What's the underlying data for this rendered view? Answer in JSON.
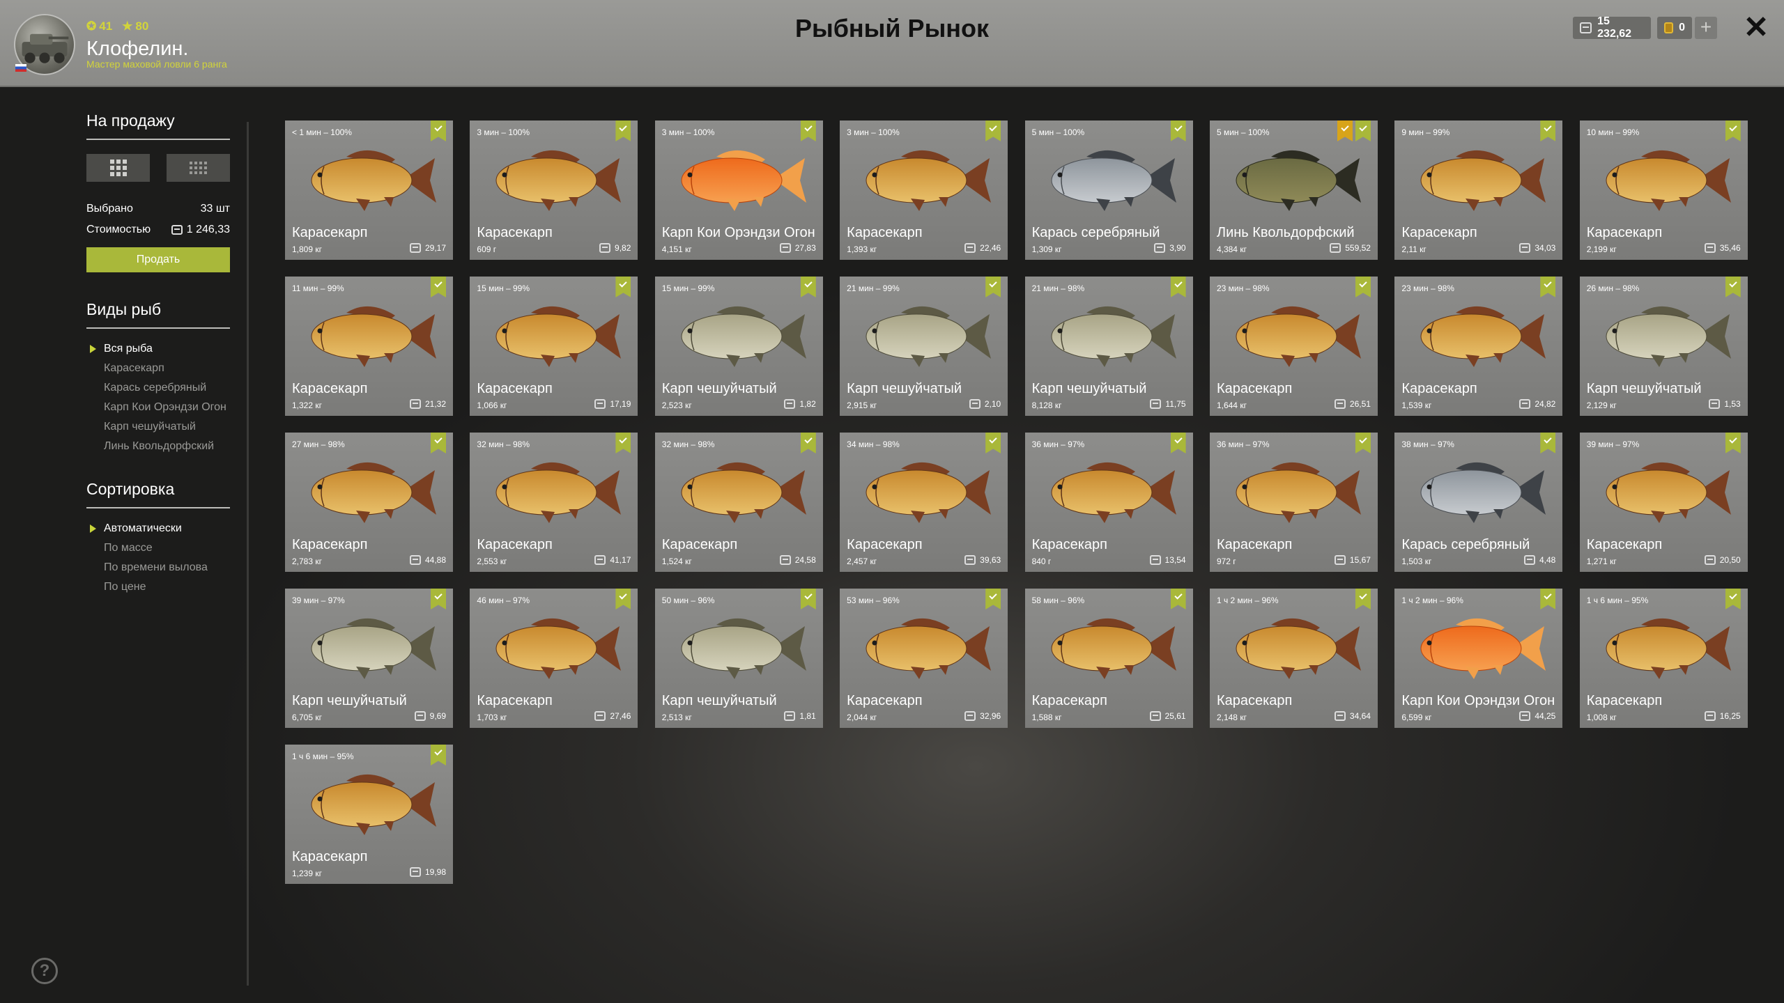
{
  "player": {
    "level": "41",
    "stars": "80",
    "name": "Клофелин.",
    "rank": "Мастер маховой ловли 6 ранга"
  },
  "title": "Рыбный Рынок",
  "currency": {
    "silver": "15 232,62",
    "gold": "0"
  },
  "sidebar": {
    "sale_title": "На продажу",
    "selected_label": "Выбрано",
    "selected_value": "33 шт",
    "cost_label": "Стоимостью",
    "cost_value": "1 246,33",
    "sell_button": "Продать",
    "species_title": "Виды рыб",
    "species": [
      "Вся рыба",
      "Карасекарп",
      "Карась серебряный",
      "Карп Кои Орэндзи Огон",
      "Карп чешуйчатый",
      "Линь Квольдорфский"
    ],
    "sort_title": "Сортировка",
    "sort": [
      "Автоматически",
      "По массе",
      "По времени вылова",
      "По цене"
    ]
  },
  "colors": {
    "accent": "#a9b83a",
    "favorite": "#d8a41a"
  },
  "fish": [
    {
      "time": "< 1 мин – 100%",
      "name": "Карасекарп",
      "weight": "1,809 кг",
      "price": "29,17",
      "kind": "crucian"
    },
    {
      "time": "3 мин – 100%",
      "name": "Карасекарп",
      "weight": "609 г",
      "price": "9,82",
      "kind": "crucian"
    },
    {
      "time": "3 мин – 100%",
      "name": "Карп Кои Орэндзи Огон",
      "weight": "4,151 кг",
      "price": "27,83",
      "kind": "koi"
    },
    {
      "time": "3 мин – 100%",
      "name": "Карасекарп",
      "weight": "1,393 кг",
      "price": "22,46",
      "kind": "crucian"
    },
    {
      "time": "5 мин – 100%",
      "name": "Карась серебряный",
      "weight": "1,309 кг",
      "price": "3,90",
      "kind": "silver"
    },
    {
      "time": "5 мин – 100%",
      "name": "Линь Квольдорфский",
      "weight": "4,384 кг",
      "price": "559,52",
      "kind": "tench",
      "favorite": true
    },
    {
      "time": "9 мин – 99%",
      "name": "Карасекарп",
      "weight": "2,11 кг",
      "price": "34,03",
      "kind": "crucian"
    },
    {
      "time": "10 мин – 99%",
      "name": "Карасекарп",
      "weight": "2,199 кг",
      "price": "35,46",
      "kind": "crucian"
    },
    {
      "time": "11 мин – 99%",
      "name": "Карасекарп",
      "weight": "1,322 кг",
      "price": "21,32",
      "kind": "crucian"
    },
    {
      "time": "15 мин – 99%",
      "name": "Карасекарп",
      "weight": "1,066 кг",
      "price": "17,19",
      "kind": "crucian"
    },
    {
      "time": "15 мин – 99%",
      "name": "Карп чешуйчатый",
      "weight": "2,523 кг",
      "price": "1,82",
      "kind": "carp"
    },
    {
      "time": "21 мин – 99%",
      "name": "Карп чешуйчатый",
      "weight": "2,915 кг",
      "price": "2,10",
      "kind": "carp"
    },
    {
      "time": "21 мин – 98%",
      "name": "Карп чешуйчатый",
      "weight": "8,128 кг",
      "price": "11,75",
      "kind": "carp"
    },
    {
      "time": "23 мин – 98%",
      "name": "Карасекарп",
      "weight": "1,644 кг",
      "price": "26,51",
      "kind": "crucian"
    },
    {
      "time": "23 мин – 98%",
      "name": "Карасекарп",
      "weight": "1,539 кг",
      "price": "24,82",
      "kind": "crucian"
    },
    {
      "time": "26 мин – 98%",
      "name": "Карп чешуйчатый",
      "weight": "2,129 кг",
      "price": "1,53",
      "kind": "carp"
    },
    {
      "time": "27 мин – 98%",
      "name": "Карасекарп",
      "weight": "2,783 кг",
      "price": "44,88",
      "kind": "crucian"
    },
    {
      "time": "32 мин – 98%",
      "name": "Карасекарп",
      "weight": "2,553 кг",
      "price": "41,17",
      "kind": "crucian"
    },
    {
      "time": "32 мин – 98%",
      "name": "Карасекарп",
      "weight": "1,524 кг",
      "price": "24,58",
      "kind": "crucian"
    },
    {
      "time": "34 мин – 98%",
      "name": "Карасекарп",
      "weight": "2,457 кг",
      "price": "39,63",
      "kind": "crucian"
    },
    {
      "time": "36 мин – 97%",
      "name": "Карасекарп",
      "weight": "840 г",
      "price": "13,54",
      "kind": "crucian"
    },
    {
      "time": "36 мин – 97%",
      "name": "Карасекарп",
      "weight": "972 г",
      "price": "15,67",
      "kind": "crucian"
    },
    {
      "time": "38 мин – 97%",
      "name": "Карась серебряный",
      "weight": "1,503 кг",
      "price": "4,48",
      "kind": "silver"
    },
    {
      "time": "39 мин – 97%",
      "name": "Карасекарп",
      "weight": "1,271 кг",
      "price": "20,50",
      "kind": "crucian"
    },
    {
      "time": "39 мин – 97%",
      "name": "Карп чешуйчатый",
      "weight": "6,705 кг",
      "price": "9,69",
      "kind": "carp"
    },
    {
      "time": "46 мин – 97%",
      "name": "Карасекарп",
      "weight": "1,703 кг",
      "price": "27,46",
      "kind": "crucian"
    },
    {
      "time": "50 мин – 96%",
      "name": "Карп чешуйчатый",
      "weight": "2,513 кг",
      "price": "1,81",
      "kind": "carp"
    },
    {
      "time": "53 мин – 96%",
      "name": "Карасекарп",
      "weight": "2,044 кг",
      "price": "32,96",
      "kind": "crucian"
    },
    {
      "time": "58 мин – 96%",
      "name": "Карасекарп",
      "weight": "1,588 кг",
      "price": "25,61",
      "kind": "crucian"
    },
    {
      "time": "1 ч 2 мин – 96%",
      "name": "Карасекарп",
      "weight": "2,148 кг",
      "price": "34,64",
      "kind": "crucian"
    },
    {
      "time": "1 ч 2 мин – 96%",
      "name": "Карп Кои Орэндзи Огон",
      "weight": "6,599 кг",
      "price": "44,25",
      "kind": "koi"
    },
    {
      "time": "1 ч 6 мин – 95%",
      "name": "Карасекарп",
      "weight": "1,008 кг",
      "price": "16,25",
      "kind": "crucian"
    },
    {
      "time": "1 ч 6 мин – 95%",
      "name": "Карасекарп",
      "weight": "1,239 кг",
      "price": "19,98",
      "kind": "crucian"
    }
  ]
}
